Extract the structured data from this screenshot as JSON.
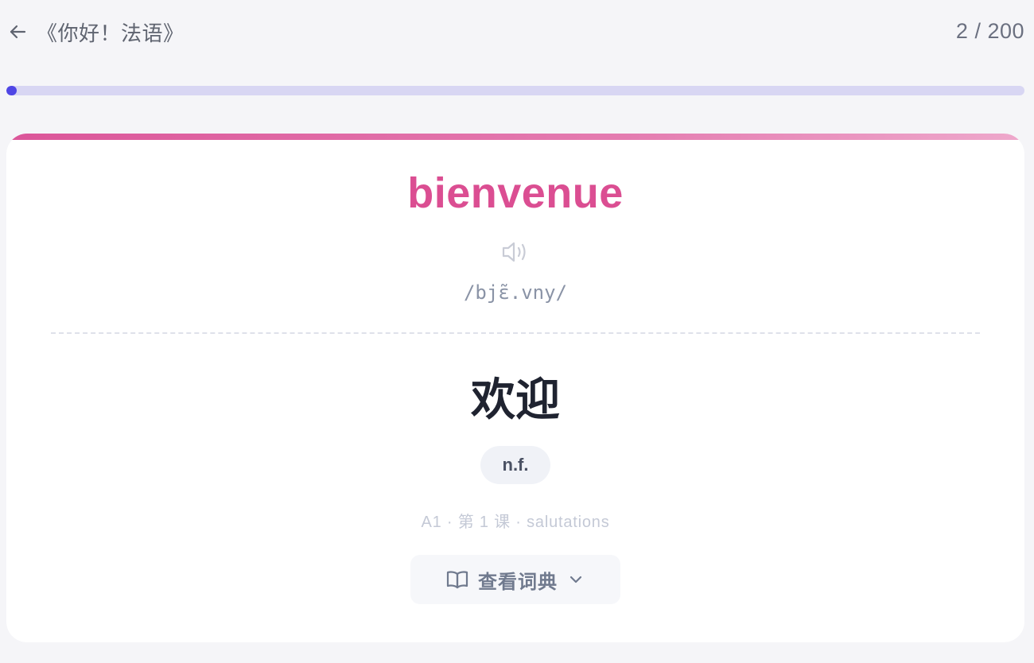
{
  "header": {
    "back_icon": "arrow-left-icon",
    "book_title": "《你好！法语》",
    "counter": "2 / 200"
  },
  "progress": {
    "current": 2,
    "total": 200,
    "fraction": 0.01,
    "track_color": "#d8d6f3",
    "fill_color": "#4f46e5"
  },
  "card": {
    "accent_gradient": [
      "#db5599",
      "#eea8cc"
    ],
    "word": "bienvenue",
    "word_color": "#db4e92",
    "audio_icon": "speaker-icon",
    "ipa": "/bjɛ̃.vny/",
    "meaning": "欢迎",
    "part_of_speech": "n.f.",
    "meta": "A1 · 第 1 课 · salutations",
    "dictionary_button": {
      "label": "查看词典",
      "icon": "book-open-icon",
      "chevron_icon": "chevron-down-icon"
    }
  }
}
